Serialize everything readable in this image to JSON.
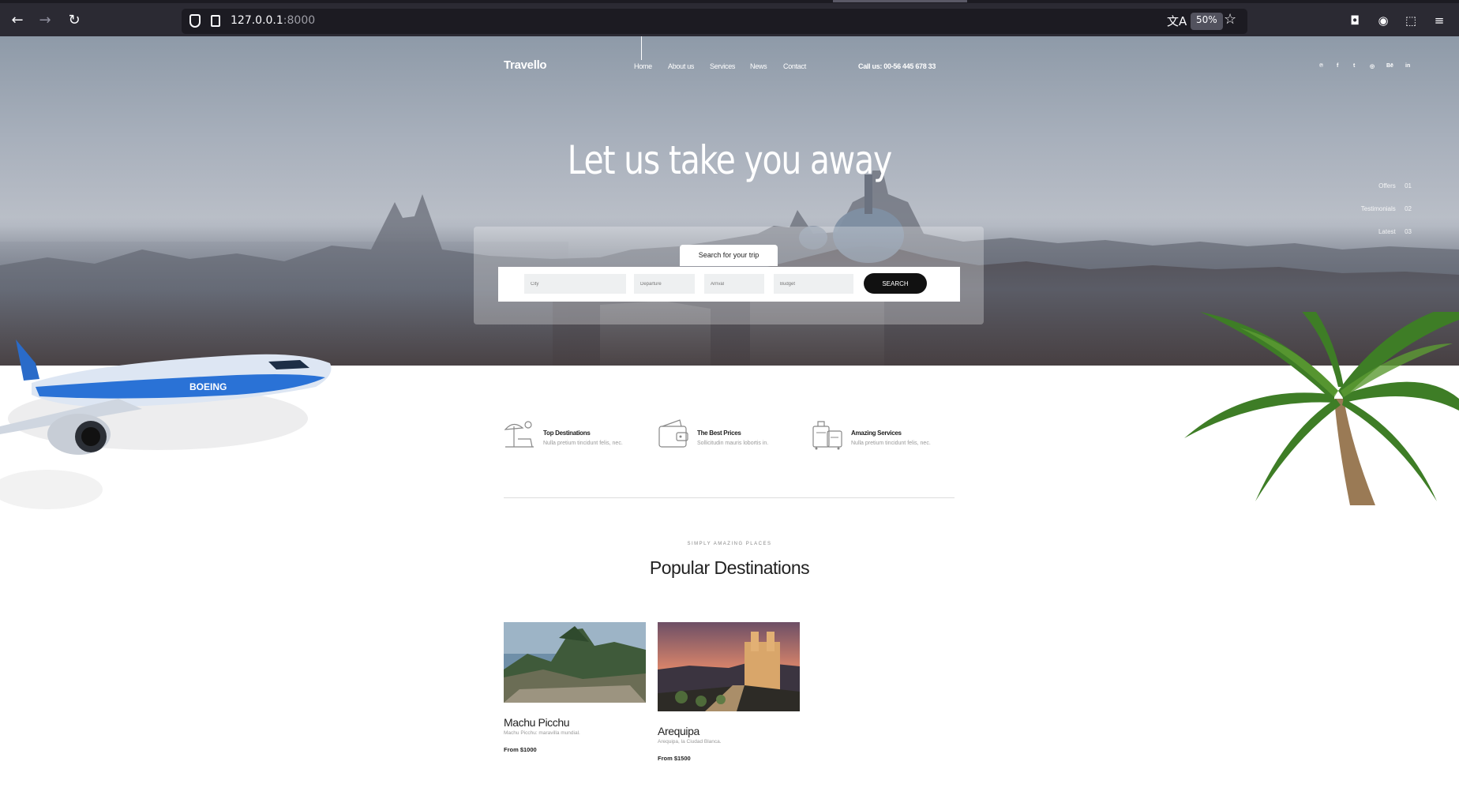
{
  "browser": {
    "url_host": "127.0.0.1",
    "url_port": ":8000",
    "zoom": "50%"
  },
  "site": {
    "logo": "Travello",
    "nav": [
      "Home",
      "About us",
      "Services",
      "News",
      "Contact"
    ],
    "call": "Call us: 00-56 445 678 33",
    "social": [
      "℗",
      "f",
      "t",
      "◎",
      "Bē",
      "in"
    ],
    "social_icons": [
      "pinterest-icon",
      "facebook-icon",
      "twitter-icon",
      "dribbble-icon",
      "behance-icon",
      "linkedin-icon"
    ]
  },
  "hero": {
    "title": "Let us take you away",
    "side_nav": [
      {
        "label": "Offers",
        "num": "01"
      },
      {
        "label": "Testimonials",
        "num": "02"
      },
      {
        "label": "Latest",
        "num": "03"
      }
    ]
  },
  "search": {
    "tab": "Search for your trip",
    "city_placeholder": "City",
    "departure_placeholder": "Departure",
    "arrival_placeholder": "Arrival",
    "budget_placeholder": "Budget",
    "button": "SEARCH"
  },
  "features": [
    {
      "title": "Top Destinations",
      "desc": "Nulla pretium tincidunt felis, nec.",
      "icon": "beach-umbrella-icon"
    },
    {
      "title": "The Best Prices",
      "desc": "Sollicitudin mauris lobortis in.",
      "icon": "wallet-icon"
    },
    {
      "title": "Amazing Services",
      "desc": "Nulla pretium tincidunt felis, nec.",
      "icon": "luggage-icon"
    }
  ],
  "popular": {
    "kicker": "SIMPLY AMAZING PLACES",
    "title": "Popular Destinations",
    "cards": [
      {
        "title": "Machu Picchu",
        "desc": "Machu Picchu: maravilla mundial.",
        "price": "From $1000"
      },
      {
        "title": "Arequipa",
        "desc": "Arequipa, la Ciudad Blanca.",
        "price": "From $1500"
      }
    ]
  }
}
